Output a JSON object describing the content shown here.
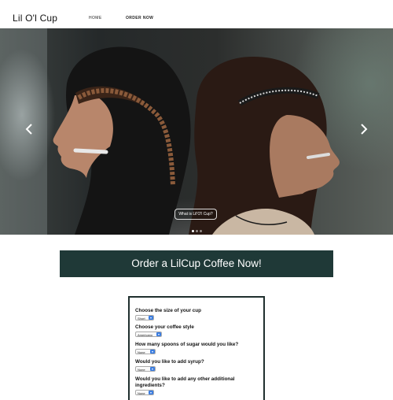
{
  "brand": "Lil O'l Cup",
  "nav": {
    "home": "HOME",
    "order": "ORDER NOW"
  },
  "hero": {
    "caption_button": "What is Lil'O'l Cup?",
    "slides_count": 3,
    "active_slide": 1
  },
  "cta": {
    "label": "Order a LilCup Coffee Now!"
  },
  "form": {
    "size_question": "Choose the size of your cup",
    "size_value": "Short",
    "style_question": "Choose your coffee style",
    "style_value": "Americano",
    "sugar_question": "How many spoons of sugar would you like?",
    "sugar_value": "None",
    "syrup_question": "Would you like to add syrup?",
    "syrup_value": "None",
    "extra_question": "Would you like to add any other additional ingredients?",
    "extra_value": "None"
  },
  "colors": {
    "cta_bg": "#1f3937",
    "form_border": "#1f2f2e",
    "select_chevron": "#3b7de0"
  }
}
